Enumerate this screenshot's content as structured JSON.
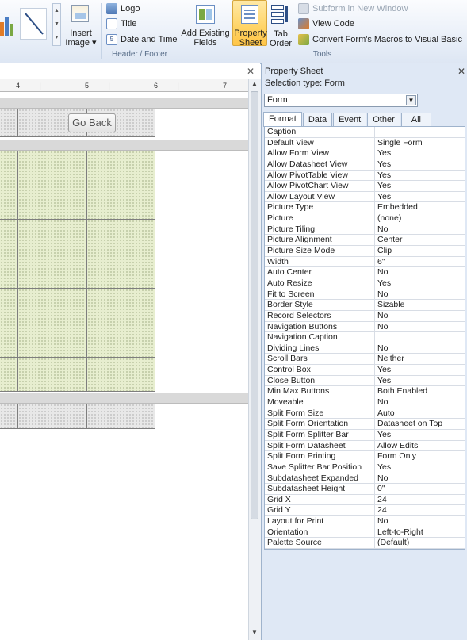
{
  "ribbon": {
    "insert_image_label_1": "Insert",
    "insert_image_label_2": "Image",
    "logo_label": "Logo",
    "title_label": "Title",
    "date_time_label": "Date and Time",
    "header_footer_caption": "Header / Footer",
    "add_existing_fields_1": "Add Existing",
    "add_existing_fields_2": "Fields",
    "property_sheet_1": "Property",
    "property_sheet_2": "Sheet",
    "tab_order_1": "Tab",
    "tab_order_2": "Order",
    "subform_new_window": "Subform in New Window",
    "view_code": "View Code",
    "convert_macros": "Convert Form's Macros to Visual Basic",
    "tools_caption": "Tools"
  },
  "design": {
    "ruler_ticks": [
      "4",
      "5",
      "6",
      "7"
    ],
    "go_back_button": "Go Back"
  },
  "property_sheet": {
    "title": "Property Sheet",
    "selection_type": "Selection type:  Form",
    "selected_object": "Form",
    "tabs": [
      "Format",
      "Data",
      "Event",
      "Other",
      "All"
    ],
    "active_tab": "Format",
    "rows": [
      {
        "k": "Caption",
        "v": ""
      },
      {
        "k": "Default View",
        "v": "Single Form"
      },
      {
        "k": "Allow Form View",
        "v": "Yes"
      },
      {
        "k": "Allow Datasheet View",
        "v": "Yes"
      },
      {
        "k": "Allow PivotTable View",
        "v": "Yes"
      },
      {
        "k": "Allow PivotChart View",
        "v": "Yes"
      },
      {
        "k": "Allow Layout View",
        "v": "Yes"
      },
      {
        "k": "Picture Type",
        "v": "Embedded"
      },
      {
        "k": "Picture",
        "v": "(none)"
      },
      {
        "k": "Picture Tiling",
        "v": "No"
      },
      {
        "k": "Picture Alignment",
        "v": "Center"
      },
      {
        "k": "Picture Size Mode",
        "v": "Clip"
      },
      {
        "k": "Width",
        "v": "6\""
      },
      {
        "k": "Auto Center",
        "v": "No"
      },
      {
        "k": "Auto Resize",
        "v": "Yes"
      },
      {
        "k": "Fit to Screen",
        "v": "No"
      },
      {
        "k": "Border Style",
        "v": "Sizable"
      },
      {
        "k": "Record Selectors",
        "v": "No"
      },
      {
        "k": "Navigation Buttons",
        "v": "No"
      },
      {
        "k": "Navigation Caption",
        "v": ""
      },
      {
        "k": "Dividing Lines",
        "v": "No"
      },
      {
        "k": "Scroll Bars",
        "v": "Neither"
      },
      {
        "k": "Control Box",
        "v": "Yes"
      },
      {
        "k": "Close Button",
        "v": "Yes"
      },
      {
        "k": "Min Max Buttons",
        "v": "Both Enabled"
      },
      {
        "k": "Moveable",
        "v": "No"
      },
      {
        "k": "Split Form Size",
        "v": "Auto"
      },
      {
        "k": "Split Form Orientation",
        "v": "Datasheet on Top"
      },
      {
        "k": "Split Form Splitter Bar",
        "v": "Yes"
      },
      {
        "k": "Split Form Datasheet",
        "v": "Allow Edits"
      },
      {
        "k": "Split Form Printing",
        "v": "Form Only"
      },
      {
        "k": "Save Splitter Bar Position",
        "v": "Yes"
      },
      {
        "k": "Subdatasheet Expanded",
        "v": "No"
      },
      {
        "k": "Subdatasheet Height",
        "v": "0\""
      },
      {
        "k": "Grid X",
        "v": "24"
      },
      {
        "k": "Grid Y",
        "v": "24"
      },
      {
        "k": "Layout for Print",
        "v": "No"
      },
      {
        "k": "Orientation",
        "v": "Left-to-Right"
      },
      {
        "k": "Palette Source",
        "v": "(Default)"
      }
    ]
  }
}
